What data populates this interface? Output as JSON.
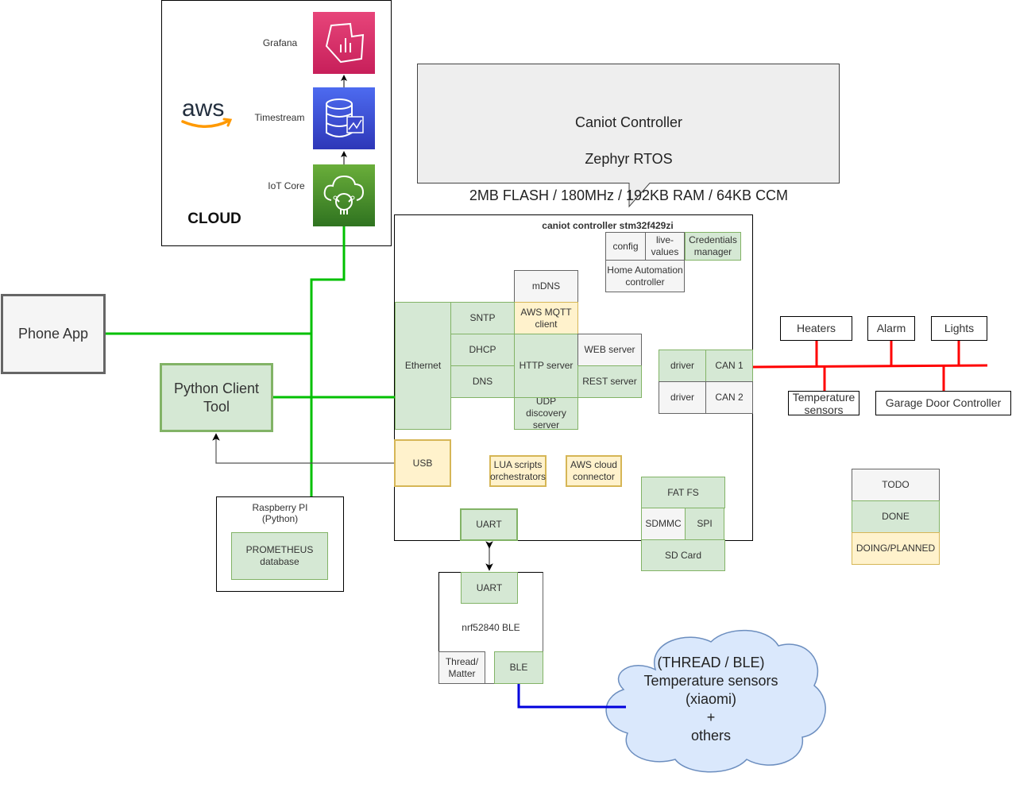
{
  "legend": {
    "todo": "TODO",
    "done": "DONE",
    "doing": "DOING/PLANNED",
    "colors": {
      "todo": "#f5f5f5",
      "done": "#d5e8d4",
      "doing": "#fff2cc"
    }
  },
  "callout": {
    "line1": "Caniot Controller",
    "line2": "Zephyr RTOS",
    "line3": "2MB FLASH / 180MHz / 192KB RAM / 64KB CCM"
  },
  "cloud": {
    "label": "CLOUD",
    "logo": "aws",
    "services": [
      {
        "name": "Grafana",
        "icon": "grafana-icon",
        "color": "#d6336c"
      },
      {
        "name": "Timestream",
        "icon": "timestream-icon",
        "color": "#3b48cc"
      },
      {
        "name": "IoT Core",
        "icon": "iot-core-icon",
        "color": "#3f8624"
      }
    ]
  },
  "clients": {
    "phone_app": "Phone App",
    "python_tool": "Python Client\nTool",
    "raspberry_title": "Raspberry PI\n(Python)",
    "prometheus": "PROMETHEUS\ndatabase"
  },
  "controller": {
    "title": "caniot controller stm32f429zi",
    "config": "config",
    "live_values": "live-\nvalues",
    "credentials": "Credentials\nmanager",
    "home_automation": "Home Automation\ncontroller",
    "mdns": "mDNS",
    "aws_mqtt": "AWS MQTT\nclient",
    "ethernet": "Ethernet",
    "sntp": "SNTP",
    "dhcp": "DHCP",
    "dns": "DNS",
    "http_server": "HTTP server",
    "web_server": "WEB server",
    "rest_server": "REST server",
    "udp_discovery": "UDP\ndiscovery\nserver",
    "usb": "USB",
    "lua": "LUA scripts\norchestrators",
    "aws_cloud": "AWS cloud\nconnector",
    "uart": "UART",
    "driver1": "driver",
    "can1": "CAN 1",
    "driver2": "driver",
    "can2": "CAN 2",
    "fatfs": "FAT FS",
    "sdmmc": "SDMMC",
    "spi": "SPI",
    "sdcard": "SD Card"
  },
  "can_bus": {
    "heaters": "Heaters",
    "alarm": "Alarm",
    "lights": "Lights",
    "temp_sensors": "Temperature\nsensors",
    "garage": "Garage Door Controller"
  },
  "nrf": {
    "uart": "UART",
    "title": "nrf52840 BLE",
    "thread": "Thread/\nMatter",
    "ble": "BLE"
  },
  "sensors_cloud": {
    "text": "(THREAD / BLE)\nTemperature sensors\n(xiaomi)\n+\nothers"
  }
}
